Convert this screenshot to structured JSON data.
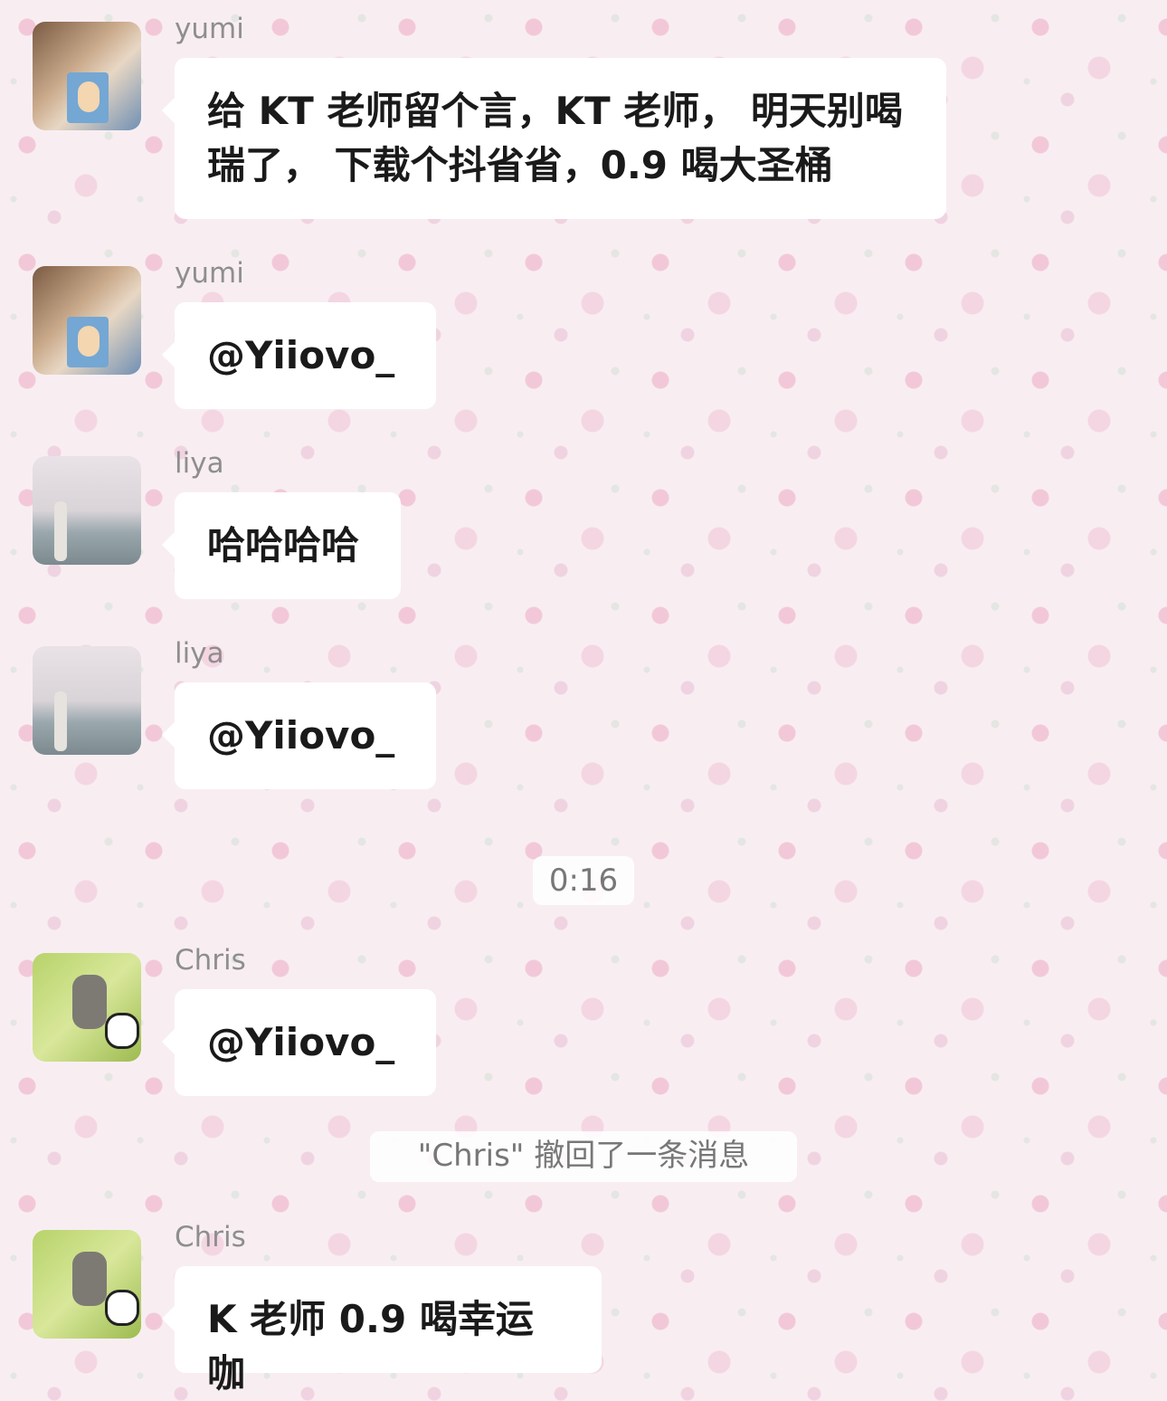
{
  "messages": [
    {
      "sender": "yumi",
      "text": "给 KT 老师留个言，KT 老师， 明天别喝瑞了， 下载个抖省省，0.9 喝大圣桶"
    },
    {
      "sender": "yumi",
      "text": "@Yiiovo_"
    },
    {
      "sender": "liya",
      "text": "哈哈哈哈"
    },
    {
      "sender": "liya",
      "text": "@Yiiovo_"
    },
    {
      "sender": "Chris",
      "text": "@Yiiovo_"
    },
    {
      "sender": "Chris",
      "text": "K 老师 0.9 喝幸运咖"
    }
  ],
  "system": {
    "timestamp": "0:16",
    "recall_notice": "\"Chris\" 撤回了一条消息"
  },
  "avatars": {
    "yumi": "yumi-photo-avatar",
    "liya": "liya-seaside-avatar",
    "chris": "chris-dog-panda-avatar"
  }
}
